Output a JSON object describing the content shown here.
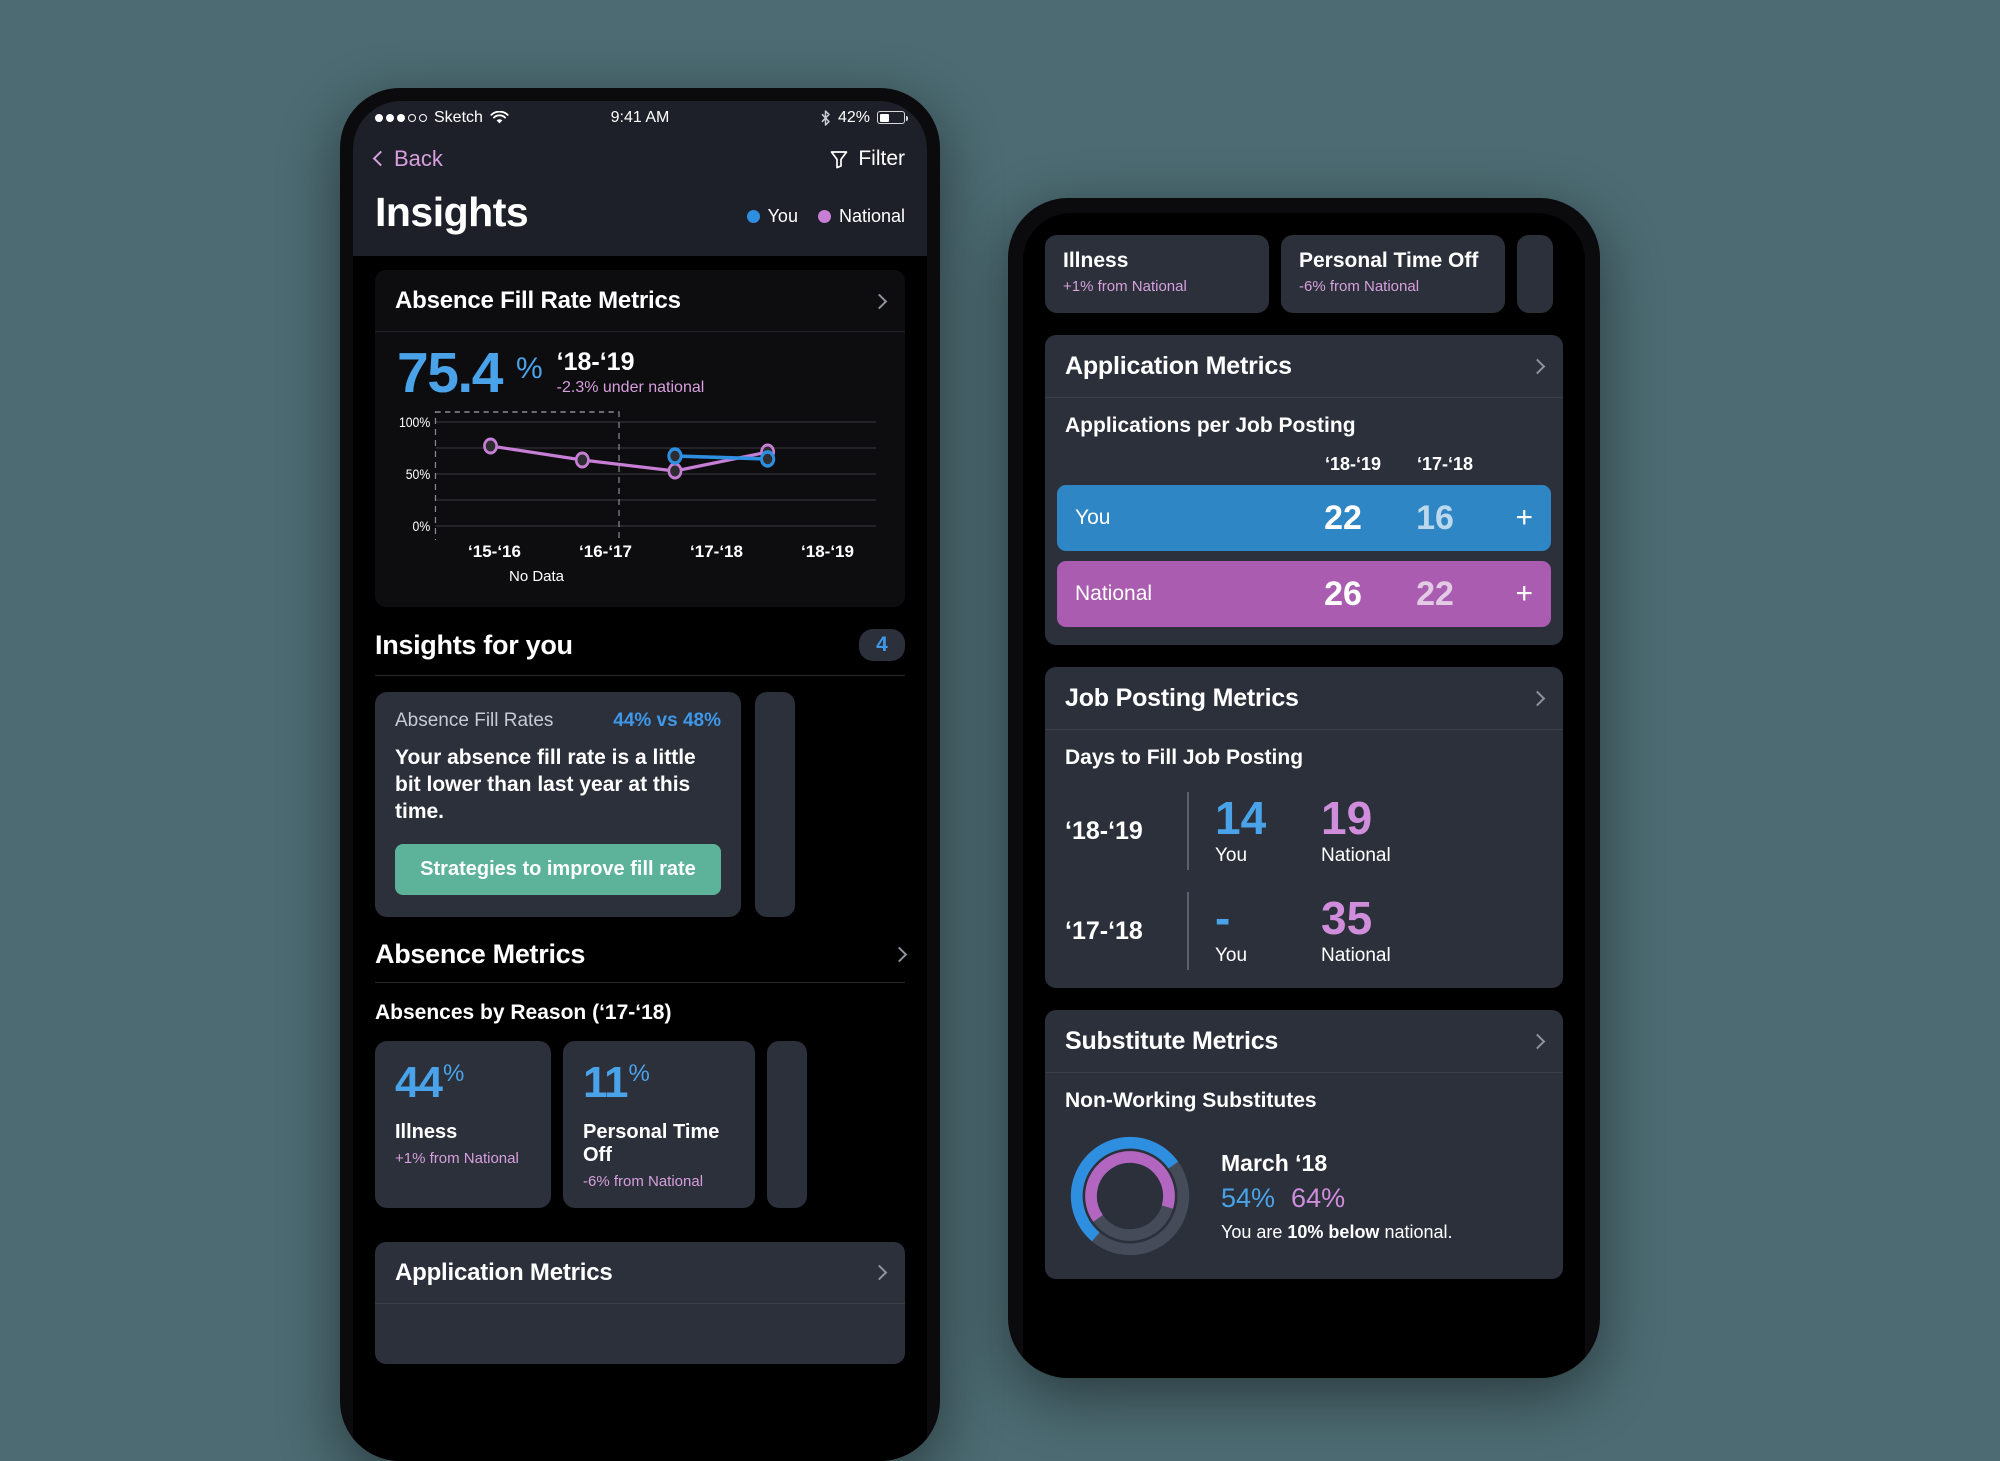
{
  "colors": {
    "background": "#4c6b72",
    "you_blue": "#4aa3e8",
    "national_purple": "#cf8ddb",
    "accent_green": "#5cb39a",
    "card_gray": "#2b303b"
  },
  "status_bar": {
    "carrier": "Sketch",
    "wifi_icon": "wifi-icon",
    "time": "9:41 AM",
    "bluetooth_icon": "bluetooth-icon",
    "battery_percent": "42%",
    "battery_icon": "battery-icon"
  },
  "nav": {
    "back_label": "Back",
    "back_icon": "chevron-left-icon",
    "filter_label": "Filter",
    "filter_icon": "funnel-icon"
  },
  "header": {
    "title": "Insights",
    "legend": [
      {
        "label": "You",
        "color": "#2e8fe0"
      },
      {
        "label": "National",
        "color": "#c77fd6"
      }
    ]
  },
  "fill_rate_card": {
    "title": "Absence Fill Rate Metrics",
    "value": "75.4",
    "unit": "%",
    "year": "‘18-‘19",
    "delta": "-2.3% under national",
    "no_data_label": "No Data"
  },
  "chart_data": {
    "type": "line",
    "title": "Absence Fill Rate Metrics",
    "categories": [
      "‘15-‘16",
      "‘16-‘17",
      "‘17-‘18",
      "‘18-‘19"
    ],
    "series": [
      {
        "name": "You",
        "color": "#2e8fe0",
        "values": [
          null,
          null,
          73,
          70
        ]
      },
      {
        "name": "National",
        "color": "#c77fd6",
        "values": [
          81,
          68,
          58,
          76
        ]
      }
    ],
    "ylabel": "",
    "xlabel": "",
    "ylim": [
      0,
      110
    ],
    "yticks": [
      0,
      50,
      100
    ],
    "ytick_labels": [
      "0%",
      "50%",
      "100%"
    ],
    "grid": true,
    "annotations": [
      {
        "text": "No Data",
        "covers": [
          "‘15-‘16",
          "‘16-‘17"
        ]
      }
    ],
    "legend_position": "top-right"
  },
  "insights_section": {
    "title": "Insights for you",
    "count": "4",
    "cards": [
      {
        "label": "Absence Fill Rates",
        "stat": "44% vs 48%",
        "text": "Your absence fill rate is a little bit lower than last year at this time.",
        "cta": "Strategies to improve fill rate"
      }
    ]
  },
  "absence_metrics": {
    "title": "Absence Metrics",
    "subtitle": "Absences by Reason (‘17-‘18)",
    "tiles": [
      {
        "value": "44",
        "unit": "%",
        "name": "Illness",
        "delta": "+1% from National"
      },
      {
        "value": "11",
        "unit": "%",
        "name": "Personal Time Off",
        "delta": "-6% from National"
      }
    ]
  },
  "application_metrics_front": {
    "title": "Application Metrics"
  },
  "back_phone": {
    "top_tiles": [
      {
        "name": "Illness",
        "delta": "+1% from National"
      },
      {
        "name": "Personal Time Off",
        "delta": "-6% from National"
      }
    ],
    "application_metrics": {
      "title": "Application Metrics",
      "subtitle": "Applications per Job Posting",
      "year_headers": [
        "‘18-‘19",
        "‘17-‘18"
      ],
      "rows": [
        {
          "who": "You",
          "values": [
            "22",
            "16"
          ],
          "plus": "+",
          "color": "#2f86c4"
        },
        {
          "who": "National",
          "values": [
            "26",
            "22"
          ],
          "plus": "+",
          "color": "#a95cb0"
        }
      ]
    },
    "job_posting_metrics": {
      "title": "Job Posting Metrics",
      "subtitle": "Days to Fill Job Posting",
      "rows": [
        {
          "year": "‘18-‘19",
          "you_value": "14",
          "you_label": "You",
          "national_value": "19",
          "national_label": "National"
        },
        {
          "year": "‘17-‘18",
          "you_value": "-",
          "you_label": "You",
          "national_value": "35",
          "national_label": "National"
        }
      ]
    },
    "substitute_metrics": {
      "title": "Substitute Metrics",
      "subtitle": "Non-Working Substitutes",
      "month": "March ‘18",
      "you_pct": "54%",
      "national_pct": "64%",
      "note_prefix": "You are ",
      "note_bold": "10% below",
      "note_suffix": " national."
    }
  }
}
